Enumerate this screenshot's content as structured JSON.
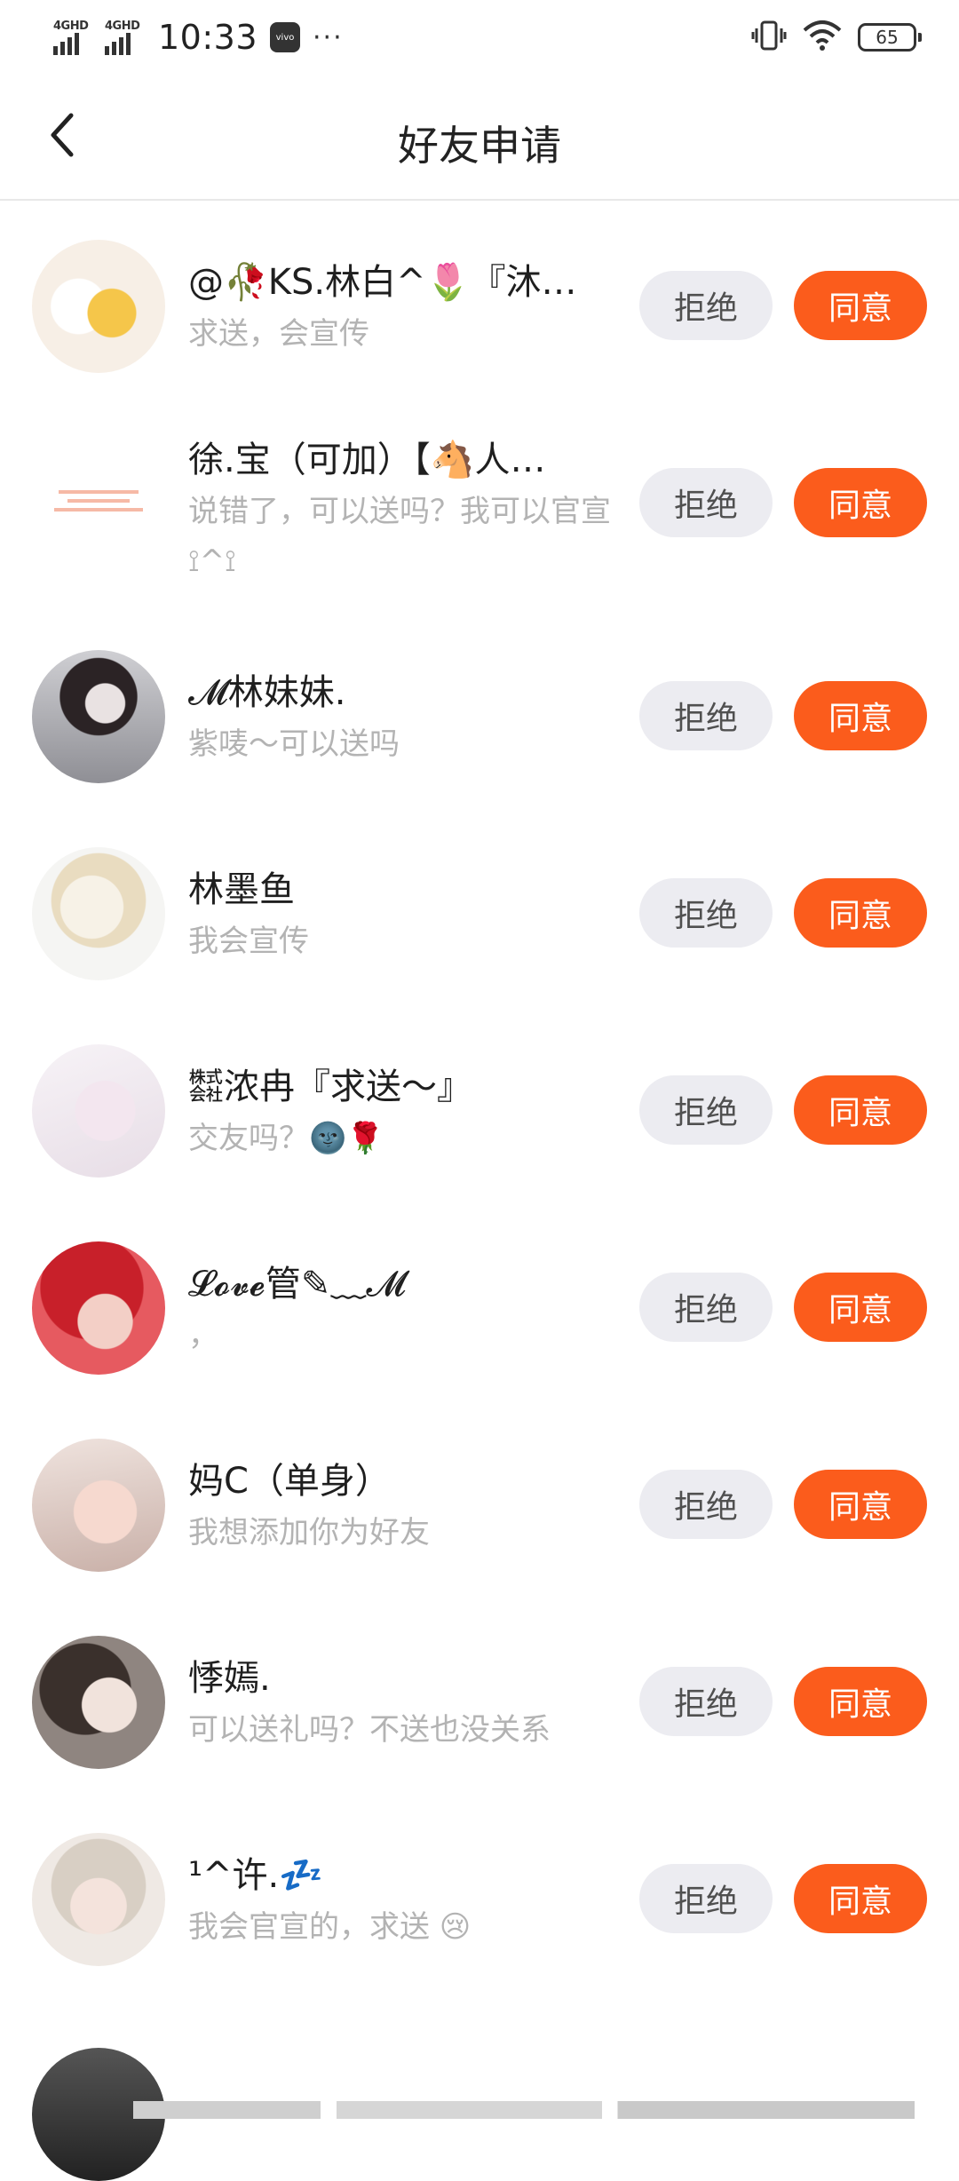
{
  "status_bar": {
    "network_1": "4GHD",
    "network_2": "4GHD",
    "time": "10:33",
    "brand": "vivo",
    "more": "···",
    "battery": "65"
  },
  "header": {
    "title": "好友申请"
  },
  "buttons": {
    "reject": "拒绝",
    "accept": "同意"
  },
  "colors": {
    "accent": "#fb5c1c",
    "reject_bg": "#ececf1",
    "subtext": "#b3b3b3"
  },
  "requests": [
    {
      "name": "@🥀KS.林白^🌷『沐…",
      "message": "求送，会宣传"
    },
    {
      "name": "徐.宝（可加）【🐴人…",
      "message": "说错了，可以送吗？我可以官宣⟟^⟟"
    },
    {
      "name": "𝓜林妹妹.",
      "message": "紫唛～可以送吗"
    },
    {
      "name": "林墨鱼",
      "message": "我会宣传"
    },
    {
      "name": "㍿浓冉『求送～』",
      "message": "交友吗？🌚🌹"
    },
    {
      "name": "𝓛𝓸𝓿𝓮管✎﹏𝓜",
      "message": "，"
    },
    {
      "name": "妈C（单身）",
      "message": "我想添加你为好友"
    },
    {
      "name": "悸嫣.",
      "message": "可以送礼吗？不送也没关系"
    },
    {
      "name": "¹^许.💤",
      "message": "我会官宣的，求送 😢"
    }
  ]
}
